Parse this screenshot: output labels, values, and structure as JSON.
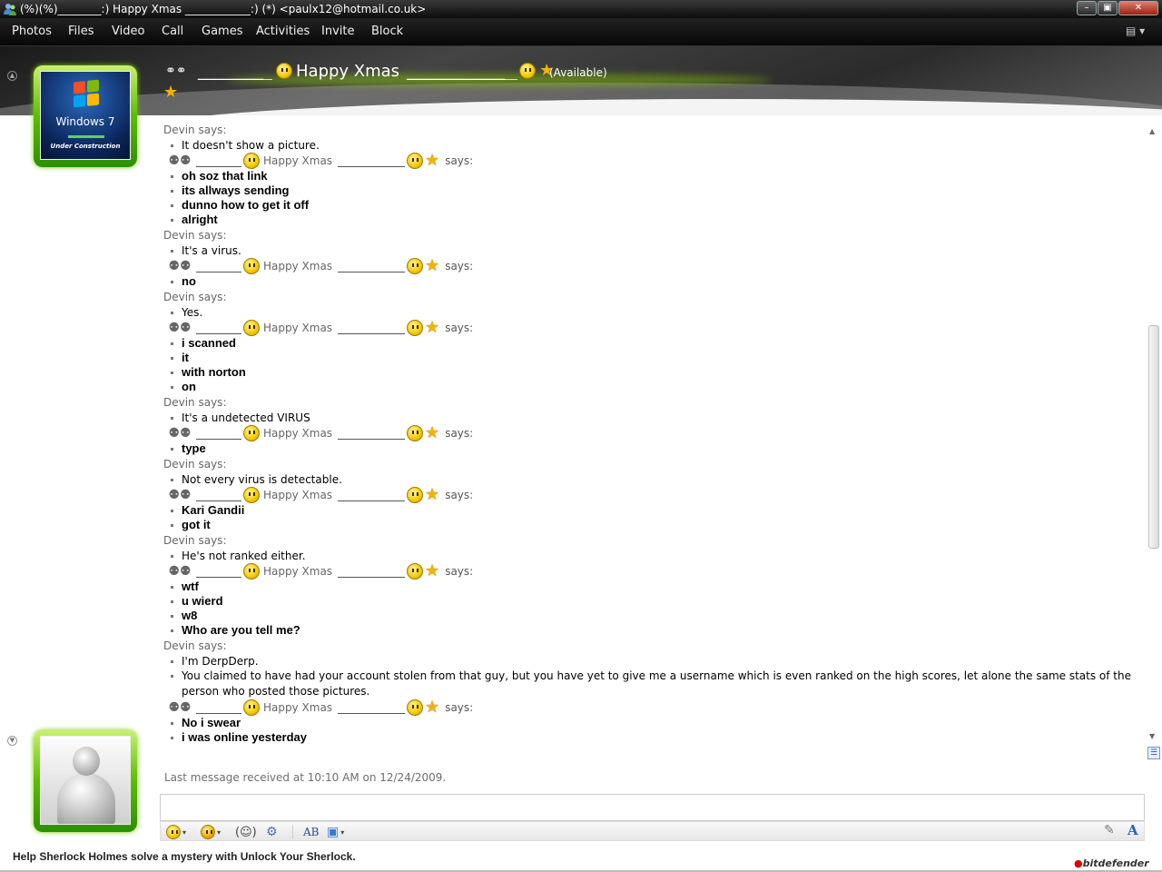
{
  "window": {
    "title": "(%)(%)________:) Happy Xmas ____________:) (*) <paulx12@hotmail.co.uk>",
    "buttons": [
      "minimize",
      "maximize",
      "close"
    ]
  },
  "menu": [
    "Photos",
    "Files",
    "Video",
    "Call",
    "Games",
    "Activities",
    "Invite",
    "Block"
  ],
  "header": {
    "name_prefix": "________",
    "name_text": "Happy Xmas",
    "name_suffix": "____________",
    "status": "(Available)"
  },
  "my_avatar": {
    "title": "Windows 7",
    "caption": "Under Construction"
  },
  "icons": {
    "friends": "friends-icon",
    "smile": "smile-icon",
    "star": "star-icon"
  },
  "sender_label": {
    "devin": "Devin says:",
    "me_name": "Happy Xmas",
    "me_says": "says:"
  },
  "conversation": [
    {
      "from": "devin",
      "messages": [
        "It doesn't show a picture."
      ]
    },
    {
      "from": "me",
      "messages": [
        "oh soz that link",
        "its allways sending",
        "dunno how to get it off",
        "alright"
      ]
    },
    {
      "from": "devin",
      "messages": [
        "It's a virus."
      ]
    },
    {
      "from": "me",
      "messages": [
        "no"
      ]
    },
    {
      "from": "devin",
      "messages": [
        "Yes."
      ]
    },
    {
      "from": "me",
      "messages": [
        "i scanned",
        "it",
        "with norton",
        "on"
      ]
    },
    {
      "from": "devin",
      "messages": [
        "It's a undetected VIRUS"
      ]
    },
    {
      "from": "me",
      "messages": [
        "type"
      ]
    },
    {
      "from": "devin",
      "messages": [
        "Not every virus is detectable."
      ]
    },
    {
      "from": "me",
      "messages": [
        "Kari Gandii",
        "got it"
      ]
    },
    {
      "from": "devin",
      "messages": [
        "He's not ranked either."
      ]
    },
    {
      "from": "me",
      "messages": [
        "wtf",
        "u wierd",
        "w8",
        "Who are you tell me?"
      ]
    },
    {
      "from": "devin",
      "messages": [
        "I'm DerpDerp.",
        "You claimed to have had your account stolen from that guy, but you have yet to give me a username which is even ranked on the high scores, let alone the same stats of the person who posted those pictures."
      ]
    },
    {
      "from": "me",
      "messages": [
        "No i swear",
        "i was online yesterday"
      ]
    }
  ],
  "last_message": "Last message received at 10:10 AM on 12/24/2009.",
  "input": {
    "value": ""
  },
  "toolbar": [
    "emoticons",
    "winks",
    "nudge",
    "voice-clip",
    "text-style",
    "backgrounds"
  ],
  "ad_text": "Help Sherlock Holmes solve a mystery with Unlock Your Sherlock.",
  "bitdefender": {
    "mark": "●",
    "text": "bitdefender"
  }
}
